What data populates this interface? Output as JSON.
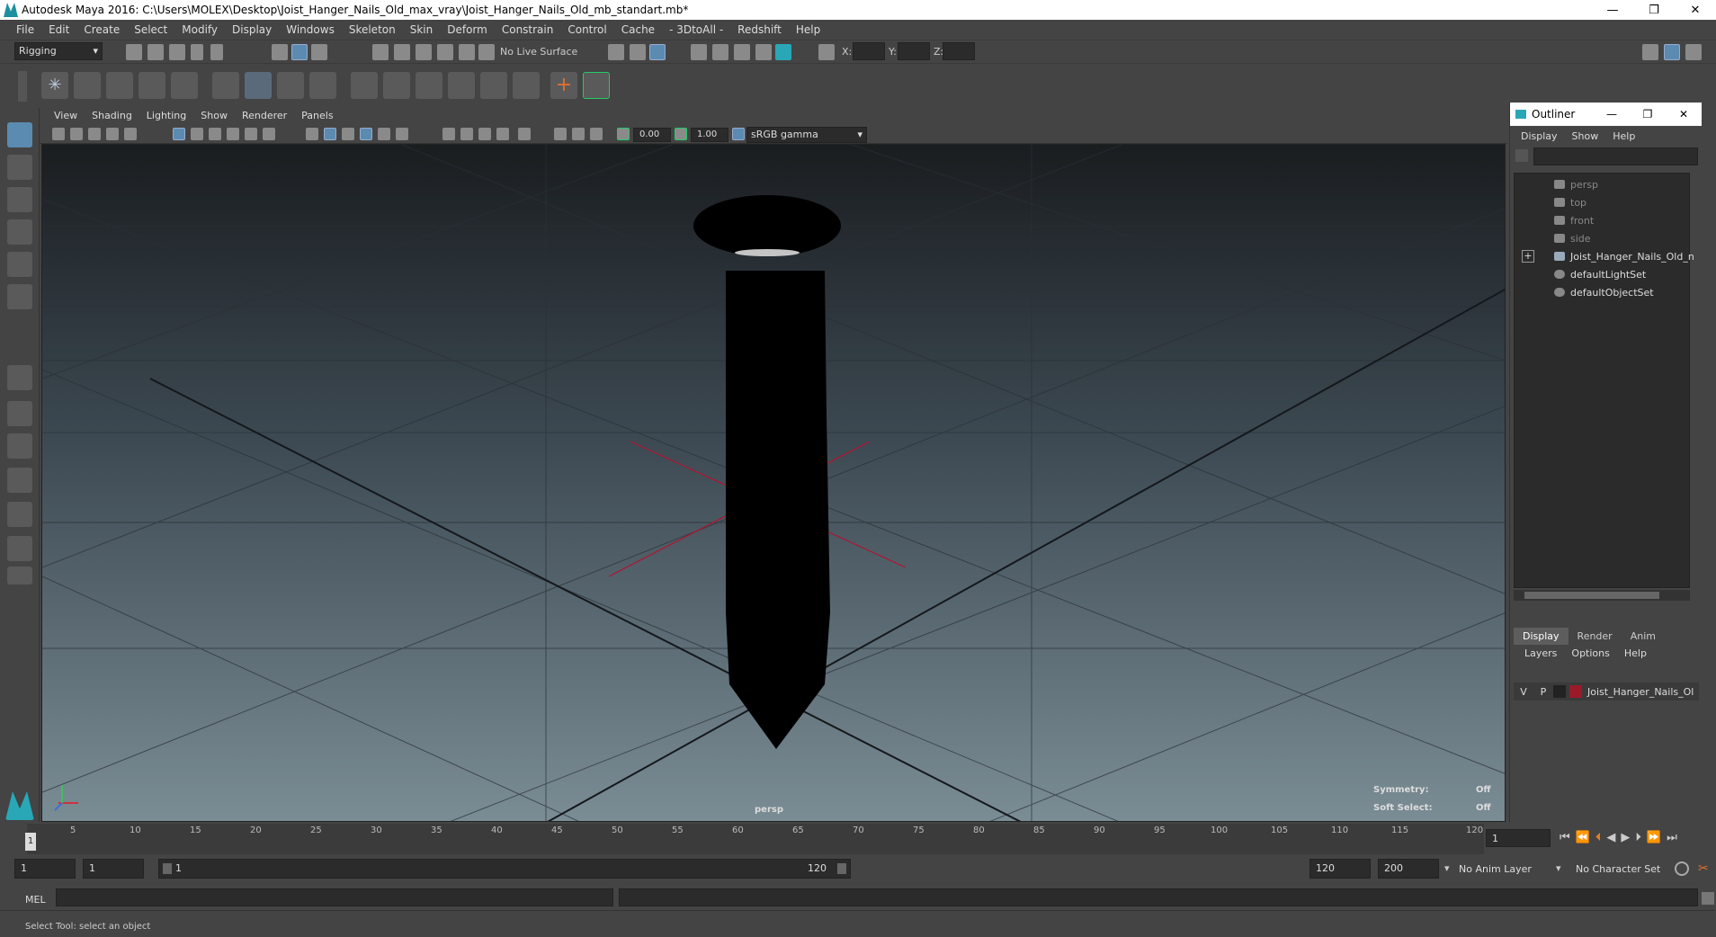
{
  "window": {
    "title": "Autodesk Maya 2016: C:\\Users\\MOLEX\\Desktop\\Joist_Hanger_Nails_Old_max_vray\\Joist_Hanger_Nails_Old_mb_standart.mb*",
    "minimize": "—",
    "restore": "❐",
    "close": "✕"
  },
  "menubar": [
    "File",
    "Edit",
    "Create",
    "Select",
    "Modify",
    "Display",
    "Windows",
    "Skeleton",
    "Skin",
    "Deform",
    "Constrain",
    "Control",
    "Cache",
    "- 3DtoAll -",
    "Redshift",
    "Help"
  ],
  "statusline": {
    "mode": "Rigging",
    "live_surface": "No Live Surface",
    "x_label": "X:",
    "y_label": "Y:",
    "z_label": "Z:"
  },
  "panel_menu": [
    "View",
    "Shading",
    "Lighting",
    "Show",
    "Renderer",
    "Panels"
  ],
  "panel_toolbar": {
    "exposure": "0.00",
    "gamma": "1.00",
    "colorspace": "sRGB gamma"
  },
  "viewport": {
    "camera": "persp",
    "symmetry_label": "Symmetry:",
    "symmetry_value": "Off",
    "soft_select_label": "Soft Select:",
    "soft_select_value": "Off"
  },
  "outliner": {
    "title": "Outliner",
    "menu": [
      "Display",
      "Show",
      "Help"
    ],
    "items": [
      {
        "label": "persp",
        "dim": true
      },
      {
        "label": "top",
        "dim": true
      },
      {
        "label": "front",
        "dim": true
      },
      {
        "label": "side",
        "dim": true
      },
      {
        "label": "Joist_Hanger_Nails_Old_n",
        "dim": false
      },
      {
        "label": "defaultLightSet",
        "dim": false
      },
      {
        "label": "defaultObjectSet",
        "dim": false
      }
    ],
    "expand": "+"
  },
  "layers": {
    "tabs": [
      "Display",
      "Render",
      "Anim"
    ],
    "menu": [
      "Layers",
      "Options",
      "Help"
    ],
    "row": {
      "v": "V",
      "p": "P",
      "name": "Joist_Hanger_Nails_Ol",
      "color": "#9b1a2a"
    }
  },
  "timeline": {
    "ticks": [
      "5",
      "10",
      "15",
      "20",
      "25",
      "30",
      "35",
      "40",
      "45",
      "50",
      "55",
      "60",
      "65",
      "70",
      "75",
      "80",
      "85",
      "90",
      "95",
      "100",
      "105",
      "110",
      "115",
      "120"
    ],
    "start_marker": "1",
    "current_frame": "1"
  },
  "range": {
    "start": "1",
    "playback_start": "1",
    "slider_start": "1",
    "slider_end": "120",
    "playback_end": "120",
    "end": "200",
    "anim_layer": "No Anim Layer",
    "character_set": "No Character Set"
  },
  "command": {
    "language": "MEL"
  },
  "help_line": "Select Tool: select an object"
}
